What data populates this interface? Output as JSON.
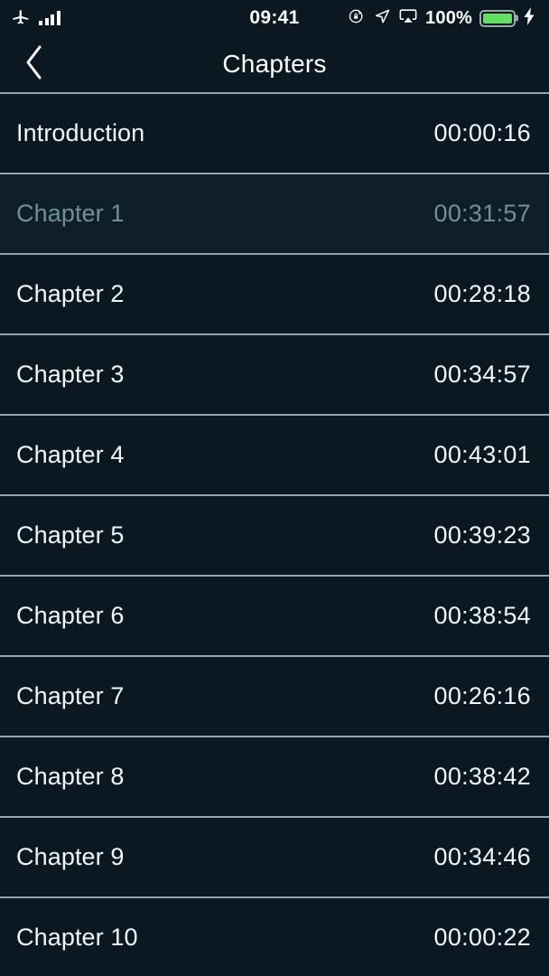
{
  "status_bar": {
    "airplane_icon": "airplane-icon",
    "signal_icon": "signal-bars-icon",
    "time": "09:41",
    "rotation_lock_icon": "rotation-lock-icon",
    "location_icon": "location-arrow-icon",
    "airplay_icon": "airplay-icon",
    "battery_percent": "100%",
    "battery_icon": "battery-icon",
    "charging_icon": "lightning-bolt-icon",
    "battery_color": "#5fe35f"
  },
  "nav": {
    "back_icon": "chevron-left-icon",
    "title": "Chapters"
  },
  "theme": {
    "background": "#0b1822",
    "active_background": "#0e1f29",
    "separator": "#93a6b0",
    "text": "#f2f6f8",
    "active_text": "#6f9292"
  },
  "chapters": [
    {
      "title": "Introduction",
      "time": "00:00:16",
      "active": false
    },
    {
      "title": "Chapter 1",
      "time": "00:31:57",
      "active": true
    },
    {
      "title": "Chapter 2",
      "time": "00:28:18",
      "active": false
    },
    {
      "title": "Chapter 3",
      "time": "00:34:57",
      "active": false
    },
    {
      "title": "Chapter 4",
      "time": "00:43:01",
      "active": false
    },
    {
      "title": "Chapter 5",
      "time": "00:39:23",
      "active": false
    },
    {
      "title": "Chapter 6",
      "time": "00:38:54",
      "active": false
    },
    {
      "title": "Chapter 7",
      "time": "00:26:16",
      "active": false
    },
    {
      "title": "Chapter 8",
      "time": "00:38:42",
      "active": false
    },
    {
      "title": "Chapter 9",
      "time": "00:34:46",
      "active": false
    },
    {
      "title": "Chapter 10",
      "time": "00:00:22",
      "active": false
    }
  ]
}
